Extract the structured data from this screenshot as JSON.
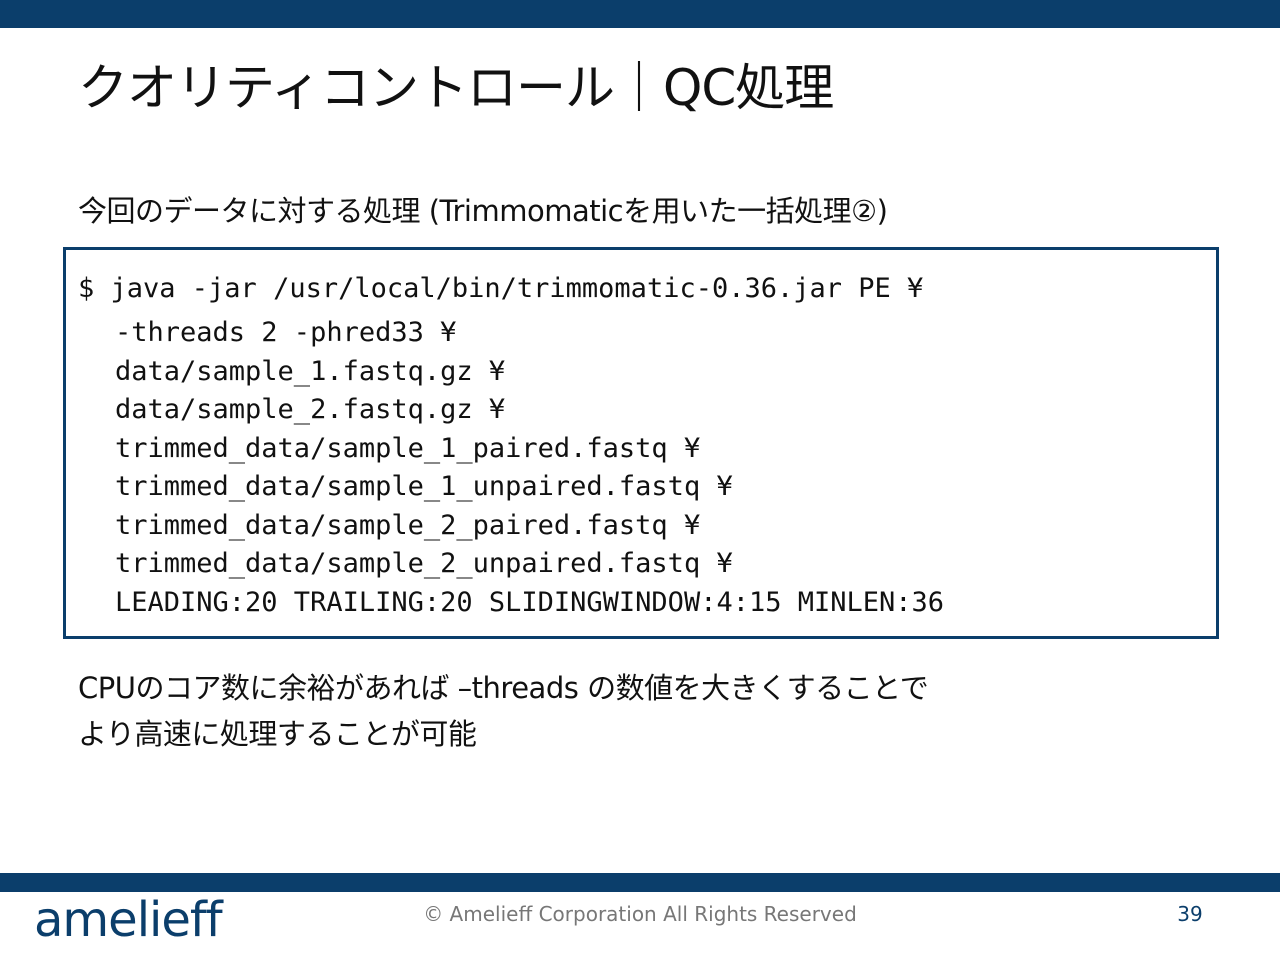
{
  "slide": {
    "title": "クオリティコントロール｜QC処理",
    "subtitle": "今回のデータに対する処理 (Trimmomaticを用いた一括処理②)"
  },
  "code": {
    "lines": [
      "$ java -jar /usr/local/bin/trimmomatic-0.36.jar PE ¥",
      "-threads 2 -phred33 ¥",
      "data/sample_1.fastq.gz ¥",
      "data/sample_2.fastq.gz ¥",
      "trimmed_data/sample_1_paired.fastq ¥",
      "trimmed_data/sample_1_unpaired.fastq ¥",
      "trimmed_data/sample_2_paired.fastq ¥",
      "trimmed_data/sample_2_unpaired.fastq ¥",
      "LEADING:20 TRAILING:20 SLIDINGWINDOW:4:15 MINLEN:36"
    ]
  },
  "note": {
    "line1": "CPUのコア数に余裕があれば –threads の数値を大きくすることで",
    "line2": "より高速に処理することが可能"
  },
  "footer": {
    "logo_text": "amelieff",
    "copyright": "© Amelieff Corporation All Rights Reserved",
    "page_number": "39"
  },
  "colors": {
    "brand": "#0b3e6b"
  }
}
